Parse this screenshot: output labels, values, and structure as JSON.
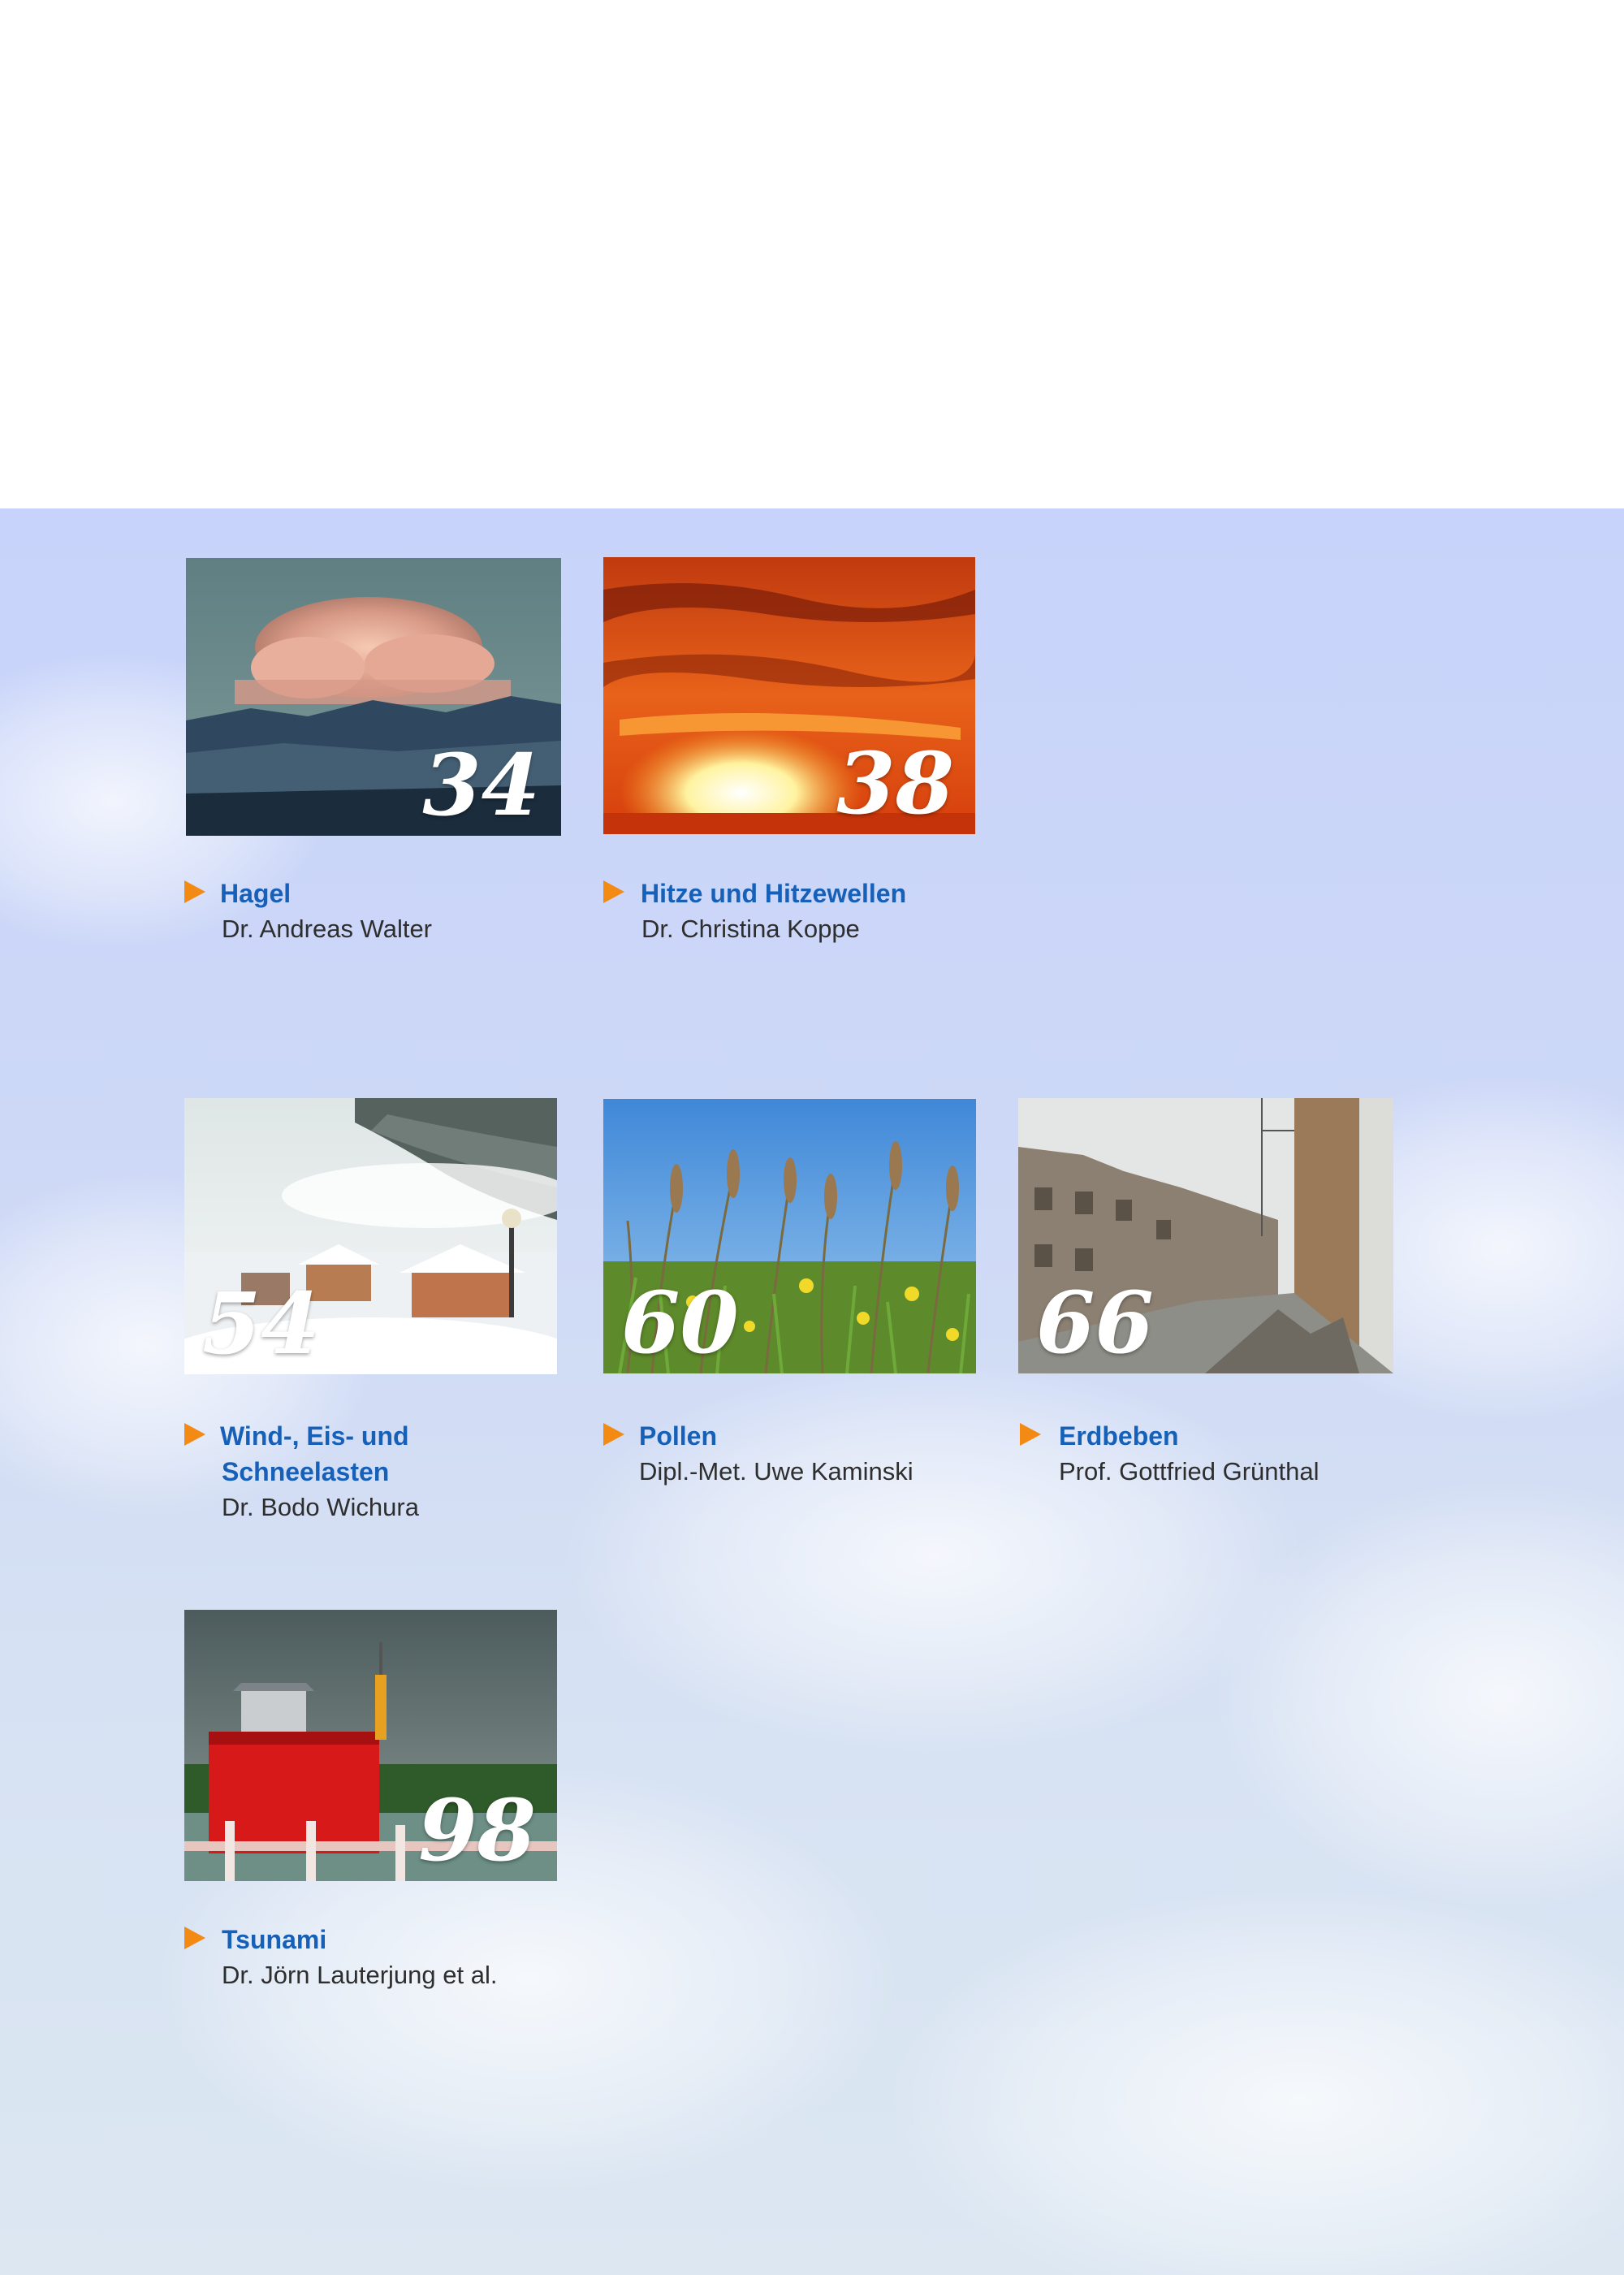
{
  "entries": [
    {
      "page": "34",
      "title": "Hagel",
      "author": "Dr. Andreas Walter"
    },
    {
      "page": "38",
      "title": "Hitze und Hitzewellen",
      "author": "Dr. Christina Koppe"
    },
    {
      "page": "54",
      "title_line1": "Wind-, Eis- und",
      "title_line2": "Schneelasten",
      "author": "Dr. Bodo Wichura"
    },
    {
      "page": "60",
      "title": "Pollen",
      "author": "Dipl.-Met. Uwe Kaminski"
    },
    {
      "page": "66",
      "title": "Erdbeben",
      "author": "Prof. Gottfried Grünthal"
    },
    {
      "page": "98",
      "title": "Tsunami",
      "author": "Dr. Jörn Lauterjung et al."
    }
  ],
  "colors": {
    "title": "#1660b8",
    "arrow": "#f28a14",
    "author": "#2e2e2e"
  },
  "images": [
    "cumulonimbus-cloud-photo",
    "sunset-photo",
    "snowy-village-photo",
    "grass-meadow-photo",
    "earthquake-ruins-photo",
    "tsunami-buoy-photo"
  ]
}
